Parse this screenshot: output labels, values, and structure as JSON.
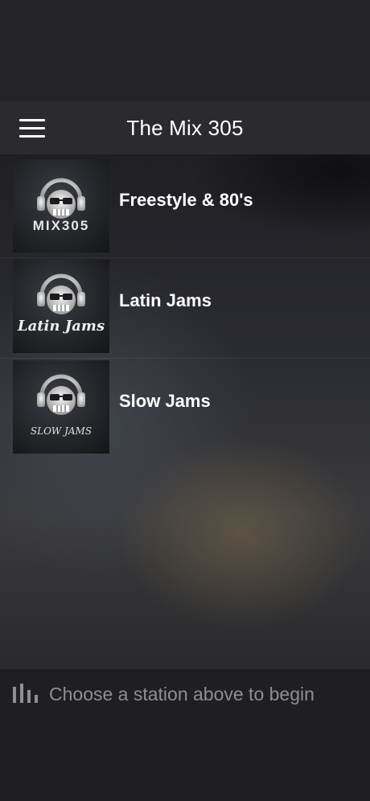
{
  "header": {
    "title": "The Mix 305"
  },
  "stations": [
    {
      "name": "Freestyle & 80's",
      "art_text": "MIX305"
    },
    {
      "name": "Latin Jams",
      "art_text": "Latin Jams"
    },
    {
      "name": "Slow Jams",
      "art_text": "SLOW JAMS"
    }
  ],
  "player": {
    "status_text": "Choose a station above to begin",
    "icon": "equalizer-icon"
  },
  "icons": {
    "menu": "hamburger-menu-icon",
    "logo": "dj-headphones-logo"
  },
  "colors": {
    "header_bg": "#2b2b2f",
    "status_bg": "#232325",
    "footer_bg": "#1f1f23",
    "title_text": "#ffffff",
    "muted_text": "#8e8e93"
  }
}
